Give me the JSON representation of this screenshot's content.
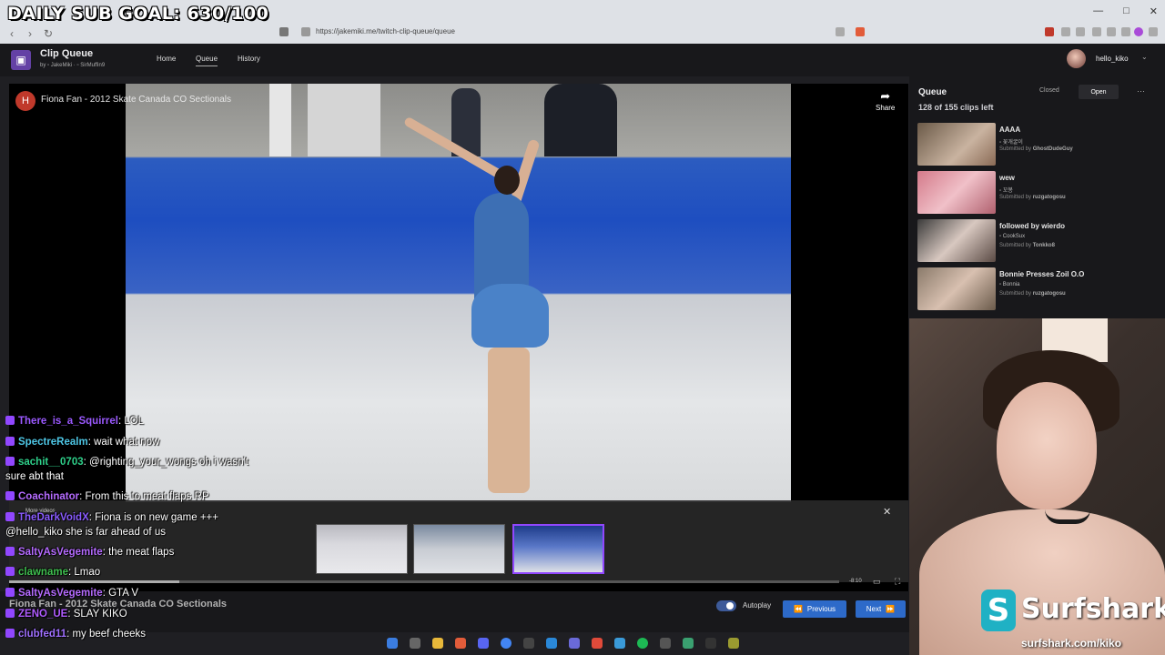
{
  "overlay": {
    "goal_text": "DAILY SUB GOAL: 630/100"
  },
  "browser": {
    "url": "https://jakemiki.me/twitch-clip-queue/queue",
    "window_controls": [
      "—",
      "□",
      "✕"
    ]
  },
  "app": {
    "title": "Clip Queue",
    "byline": "by ▫ JakeMiki · ▫ SirMuffin9",
    "nav": [
      "Home",
      "Queue",
      "History"
    ],
    "user": "hello_kiko"
  },
  "video": {
    "channel_initial": "H",
    "title": "Fiona Fan - 2012 Skate Canada CO Sectionals",
    "share_label": "Share",
    "more_videos_label": "More videos",
    "time_left": "-8:10",
    "progress": 0.205
  },
  "footer": {
    "clip_title": "Fiona Fan - 2012 Skate Canada CO Sectionals",
    "autoplay_label": "Autoplay",
    "previous_label": "Previous",
    "next_label": "Next"
  },
  "queue": {
    "title": "Queue",
    "count": "128 of 155 clips left",
    "closed_label": "Closed",
    "open_label": "Open",
    "items": [
      {
        "name": "AAAA",
        "channel": "▫ 꽃개굴이",
        "submitted_prefix": "Submitted by",
        "submitter": "GhostDudeGuy"
      },
      {
        "name": "wew",
        "channel": "▫ 꼬봉",
        "submitted_prefix": "Submitted by",
        "submitter": "ruzgatogosu"
      },
      {
        "name": "followed by wierdo",
        "channel": "▫ CookSux",
        "submitted_prefix": "Submitted by",
        "submitter": "Tonkko8"
      },
      {
        "name": "Bonnie Presses Zoil O.O",
        "channel": "▫ Bonnia",
        "submitted_prefix": "Submitted by",
        "submitter": "ruzgatogosu"
      }
    ]
  },
  "chat": [
    {
      "user": "There_is_a_Squirrel",
      "color": "#9b59ff",
      "text": "LOL"
    },
    {
      "user": "SpectreRealm",
      "color": "#4ec7e6",
      "text": "wait what now"
    },
    {
      "user": "sachit__0703",
      "color": "#2ed08a",
      "text": "@righting_your_wongs oh i wasn't sure abt that"
    },
    {
      "user": "Coachinator",
      "color": "#b56bff",
      "text": "From this to meat flaps RP"
    },
    {
      "user": "TheDarkVoidX",
      "color": "#8a5cff",
      "text": "Fiona is on new game +++ @hello_kiko she is far ahead of us"
    },
    {
      "user": "SaltyAsVegemite",
      "color": "#b56bff",
      "text": "the meat flaps"
    },
    {
      "user": "clawname",
      "color": "#3fbf4f",
      "text": "Lmao"
    },
    {
      "user": "SaltyAsVegemite",
      "color": "#b56bff",
      "text": "GTA V"
    },
    {
      "user": "ZENO_UE",
      "color": "#b05cff",
      "text": "SLAY KIKO"
    },
    {
      "user": "clubfed11",
      "color": "#a070ff",
      "text": "my beef cheeks"
    }
  ],
  "sponsor": {
    "name": "Surfshark",
    "logo_letter": "S",
    "url": "surfshark.com/kiko"
  },
  "colors": {
    "accent": "#2d6ac9",
    "twitch_purple": "#9147ff"
  }
}
